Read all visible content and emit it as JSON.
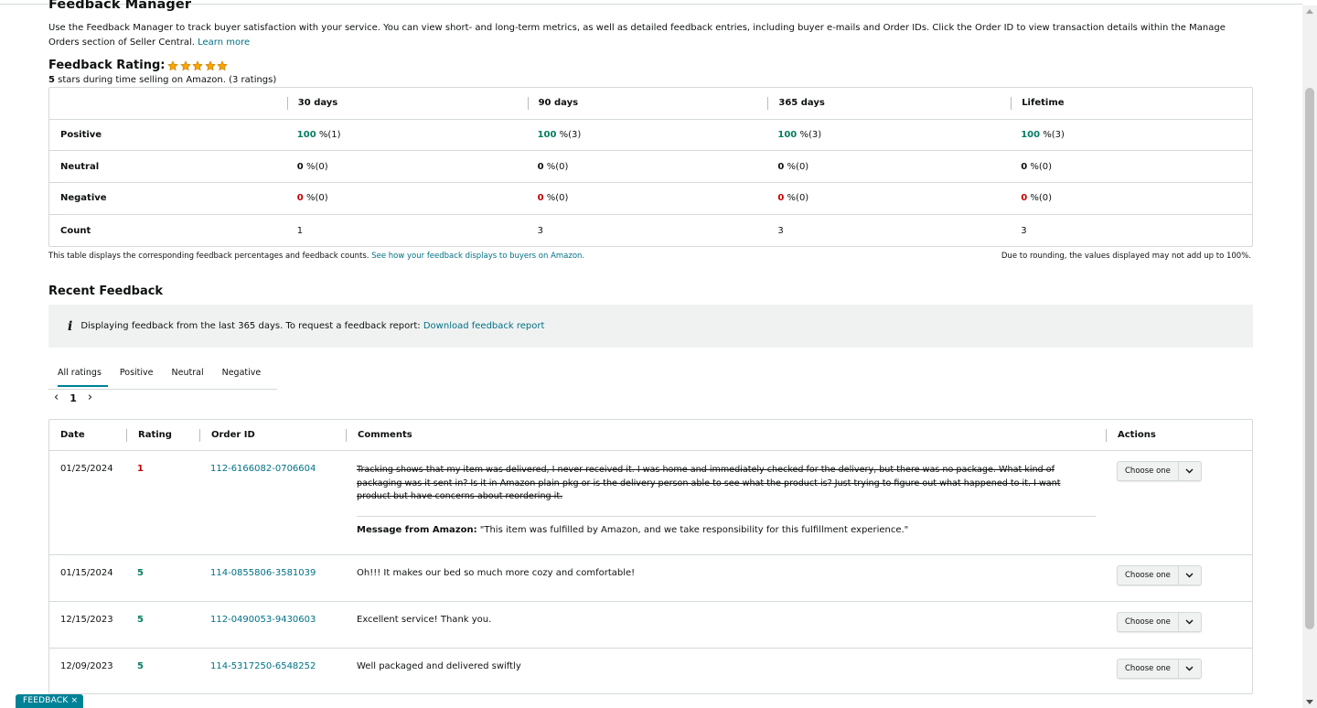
{
  "page": {
    "title": "Feedback Manager",
    "intro": "Use the Feedback Manager to track buyer satisfaction with your service. You can view short- and long-term metrics, as well as detailed feedback entries, including buyer e-mails and Order IDs. Click the Order ID to view transaction details within the Manage Orders section of Seller Central.",
    "learn_more": "Learn more"
  },
  "rating": {
    "title": "Feedback Rating:",
    "stars": 5,
    "star_color": "#f7a600",
    "summary_bold": "5",
    "summary_rest": " stars during time selling on Amazon. (3 ratings)"
  },
  "metrics": {
    "headers": [
      "30 days",
      "90 days",
      "365 days",
      "Lifetime"
    ],
    "rows": [
      {
        "label": "Positive",
        "cells": [
          {
            "num": "100",
            "rest": " %(1)"
          },
          {
            "num": "100",
            "rest": " %(3)"
          },
          {
            "num": "100",
            "rest": " %(3)"
          },
          {
            "num": "100",
            "rest": " %(3)"
          }
        ]
      },
      {
        "label": "Neutral",
        "cells": [
          {
            "num": "0",
            "rest": " %(0)"
          },
          {
            "num": "0",
            "rest": " %(0)"
          },
          {
            "num": "0",
            "rest": " %(0)"
          },
          {
            "num": "0",
            "rest": " %(0)"
          }
        ]
      },
      {
        "label": "Negative",
        "cells": [
          {
            "num": "0",
            "rest": " %(0)"
          },
          {
            "num": "0",
            "rest": " %(0)"
          },
          {
            "num": "0",
            "rest": " %(0)"
          },
          {
            "num": "0",
            "rest": " %(0)"
          }
        ]
      },
      {
        "label": "Count",
        "cells": [
          {
            "num": "1"
          },
          {
            "num": "3"
          },
          {
            "num": "3"
          },
          {
            "num": "3"
          }
        ]
      }
    ],
    "note_left": "This table displays the corresponding feedback percentages and feedback counts.",
    "note_link": "See how your feedback displays to buyers on Amazon.",
    "note_right": "Due to rounding, the values displayed may not add up to 100%."
  },
  "recent": {
    "title": "Recent Feedback",
    "info_text": "Displaying feedback from the last 365 days. To request a feedback report:",
    "info_link": "Download feedback report",
    "tabs": [
      "All ratings",
      "Positive",
      "Neutral",
      "Negative"
    ],
    "page_number": "1"
  },
  "feedback_table": {
    "headers": [
      "Date",
      "Rating",
      "Order ID",
      "Comments",
      "Actions"
    ],
    "rows": [
      {
        "date": "01/25/2024",
        "rating": "1",
        "order_id": "112-6166082-0706604",
        "comment": "Tracking shows that my item was delivered, I never received it. I was home and immediately checked for the delivery, but there was no package. What kind of packaging was it sent in? Is it in Amazon plain pkg or is the delivery person able to see what the product is? Just trying to figure out what happened to it. I want product but have concerns about reordering it.",
        "amazon_label": "Message from Amazon:",
        "amazon_msg": " \"This item was fulfilled by Amazon, and we take responsibility for this fulfillment experience.\"",
        "action": "Choose one"
      },
      {
        "date": "01/15/2024",
        "rating": "5",
        "order_id": "114-0855806-3581039",
        "comment": "Oh!!! It makes our bed so much more cozy and comfortable!",
        "action": "Choose one"
      },
      {
        "date": "12/15/2023",
        "rating": "5",
        "order_id": "112-0490053-9430603",
        "comment": "Excellent service! Thank you.",
        "action": "Choose one"
      },
      {
        "date": "12/09/2023",
        "rating": "5",
        "order_id": "114-5317250-6548252",
        "comment": "Well packaged and delivered swiftly",
        "action": "Choose one"
      }
    ]
  },
  "feedback_tab": {
    "label": "FEEDBACK",
    "close": "×"
  },
  "colors": {
    "link": "#007185",
    "positive": "#067d62",
    "negative": "#c40000",
    "accent": "#008296"
  }
}
